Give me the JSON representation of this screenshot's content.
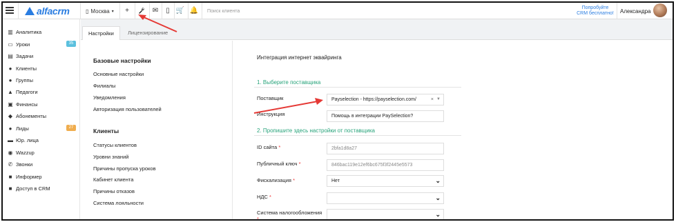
{
  "topbar": {
    "logo_text": "alfacrm",
    "city": "Москва",
    "search_placeholder": "Поиск клиента",
    "try_free": "Попробуйте CRM бесплатно!",
    "user_name": "Александра",
    "icons": [
      "menu-icon",
      "plus-icon",
      "wrench-icon",
      "mail-icon",
      "phone-icon",
      "cart-icon",
      "bell-icon"
    ]
  },
  "sidebar": {
    "items": [
      {
        "label": "Аналитика",
        "icon": "chart-icon"
      },
      {
        "label": "Уроки",
        "icon": "lessons-icon",
        "badge": "35"
      },
      {
        "label": "Задачи",
        "icon": "tasks-icon"
      },
      {
        "label": "Клиенты",
        "icon": "user-icon"
      },
      {
        "label": "Группы",
        "icon": "group-icon"
      },
      {
        "label": "Педагоги",
        "icon": "teacher-icon"
      },
      {
        "label": "Финансы",
        "icon": "money-icon"
      },
      {
        "label": "Абонементы",
        "icon": "tag-icon"
      },
      {
        "label": "Лиды",
        "icon": "leads-icon",
        "badge": "27"
      },
      {
        "label": "Юр. лица",
        "icon": "bank-icon"
      },
      {
        "label": "Wazzup",
        "icon": "whatsapp-icon"
      },
      {
        "label": "Звонки",
        "icon": "call-icon"
      },
      {
        "label": "Информер",
        "icon": "informer-icon"
      },
      {
        "label": "Доступ в CRM",
        "icon": "lock-icon"
      }
    ]
  },
  "tabs": [
    {
      "label": "Настройки",
      "active": true
    },
    {
      "label": "Лицензирование",
      "active": false
    }
  ],
  "settings_nav": {
    "groups": [
      {
        "title": "Базовые настройки",
        "links": [
          "Основные настройки",
          "Филиалы",
          "Уведомления",
          "Авторизация пользователей"
        ]
      },
      {
        "title": "Клиенты",
        "links": [
          "Статусы клиентов",
          "Уровни знаний",
          "Причины пропуска уроков",
          "Кабинет клиента",
          "Причины отказов",
          "Система лояльности"
        ]
      }
    ]
  },
  "form": {
    "title": "Интеграция интернет эквайринга",
    "section1": "1. Выберите поставщика",
    "section2": "2. Пропишите здесь настройки от поставщика",
    "provider_label": "Поставщик",
    "provider_value": "Payselection - https://payselection.com/",
    "instruction_label": "Инструкция",
    "instruction_value": "Помощь в интеграции PaySelection?",
    "site_id_label": "ID сайта",
    "site_id_value": "2bfa1d8a27",
    "public_key_label": "Публичный ключ",
    "public_key_value": "846bac119e12ef6bc675f3f2445e5573",
    "fiscal_label": "Фискализация",
    "fiscal_value": "Нет",
    "vat_label": "НДС",
    "vat_value": "",
    "tax_label": "Система налогообложения",
    "tax_value": "",
    "required_mark": "*"
  },
  "colors": {
    "brand": "#2a7de1",
    "section": "#27a37a",
    "badge_blue": "#5bc0de",
    "badge_orange": "#f0ad4e",
    "arrow": "#e53935"
  }
}
